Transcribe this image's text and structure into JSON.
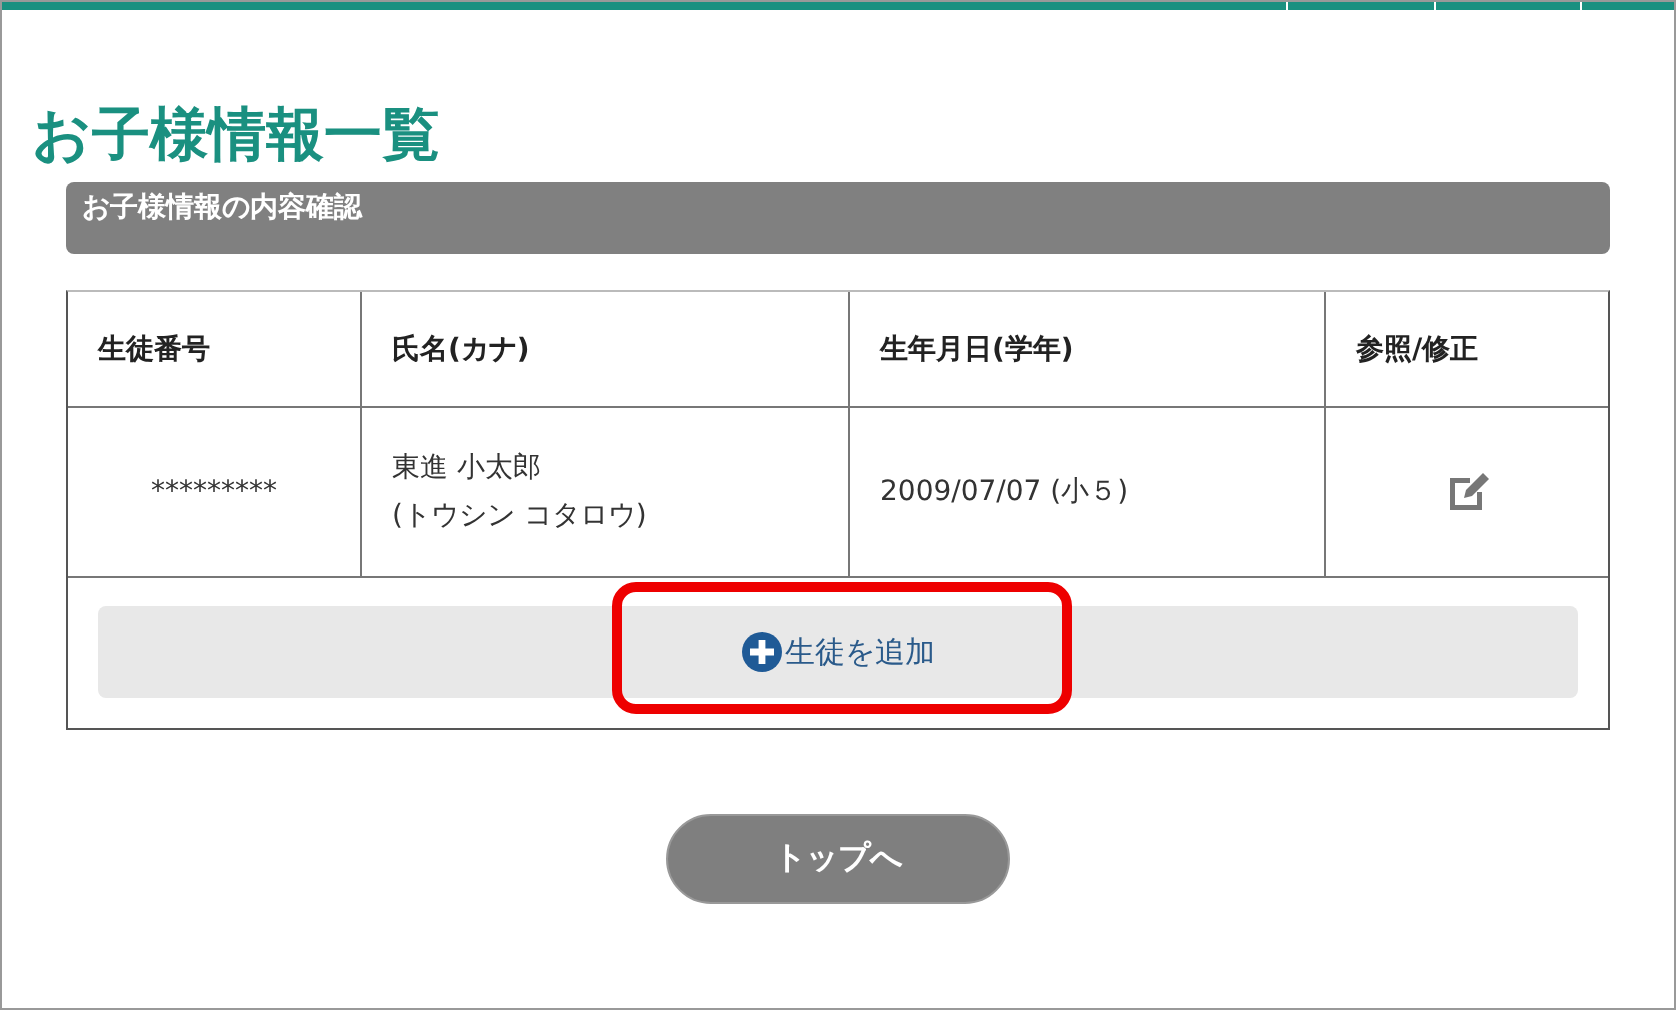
{
  "page_title": "お子様情報一覧",
  "section": {
    "title": "お子様情報の内容確認"
  },
  "table": {
    "columns": [
      "生徒番号",
      "氏名(カナ)",
      "生年月日(学年)",
      "参照/修正"
    ],
    "rows": [
      {
        "student_no": "*********",
        "name": "東進 小太郎",
        "kana": "(トウシン コタロウ)",
        "birth": "2009/07/07 (小５)"
      }
    ]
  },
  "add_button": {
    "label": "生徒を追加",
    "highlighted": true
  },
  "top_button": {
    "label": "トップへ"
  }
}
